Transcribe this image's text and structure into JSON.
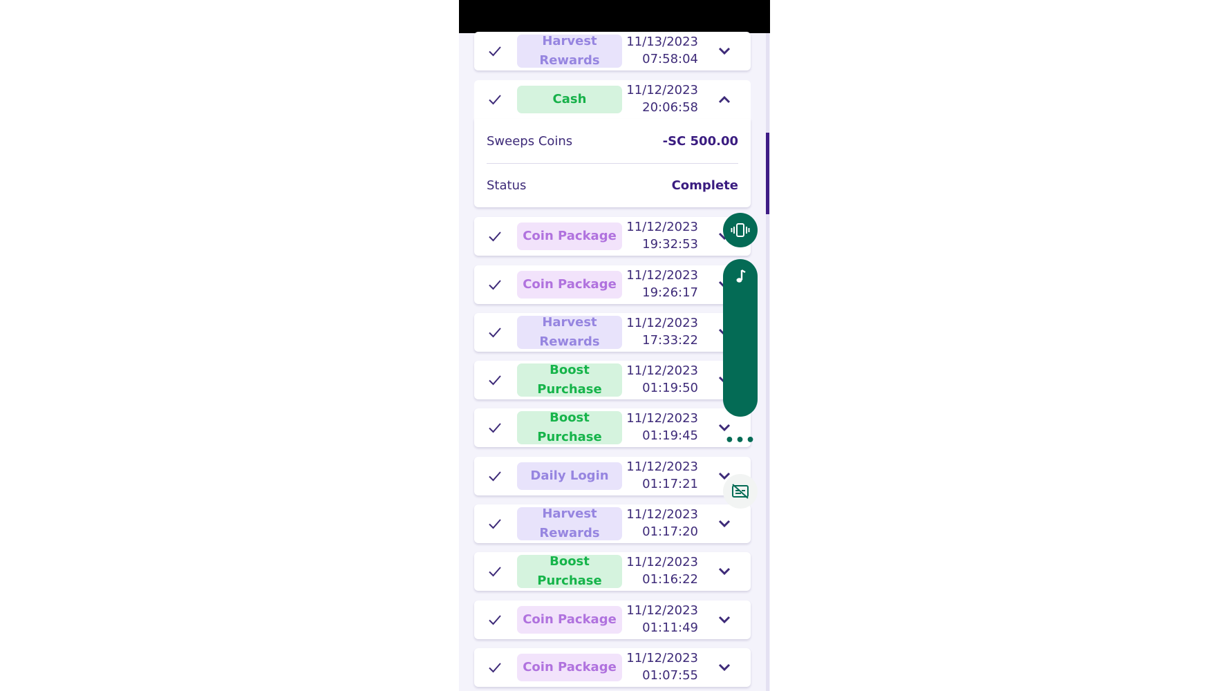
{
  "icons": {
    "check": "check-icon",
    "chevron_down": "chevron-down-icon",
    "chevron_up": "chevron-up-icon",
    "vibrate": "vibrate-icon",
    "music": "music-note-icon",
    "more": "more-dots-icon",
    "captions_off": "captions-off-icon"
  },
  "colors": {
    "accent": "#3d2a78",
    "float_button": "#046b55",
    "chip_harvest_bg": "#e8e3fb",
    "chip_cash_bg": "#d5f3de",
    "chip_coin_bg": "#f2e3fb"
  },
  "transactions": [
    {
      "type": "Harvest Rewards",
      "type_line1": "Harvest",
      "type_line2": "Rewards",
      "date": "11/13/2023",
      "time": "07:58:04",
      "expanded": false
    },
    {
      "type": "Cash",
      "type_line1": "Cash",
      "type_line2": "",
      "date": "11/12/2023",
      "time": "20:06:58",
      "expanded": true
    },
    {
      "type": "Coin Package",
      "type_line1": "Coin Package",
      "type_line2": "",
      "date": "11/12/2023",
      "time": "19:32:53",
      "expanded": false
    },
    {
      "type": "Coin Package",
      "type_line1": "Coin Package",
      "type_line2": "",
      "date": "11/12/2023",
      "time": "19:26:17",
      "expanded": false
    },
    {
      "type": "Harvest Rewards",
      "type_line1": "Harvest",
      "type_line2": "Rewards",
      "date": "11/12/2023",
      "time": "17:33:22",
      "expanded": false
    },
    {
      "type": "Boost Purchase",
      "type_line1": "Boost",
      "type_line2": "Purchase",
      "date": "11/12/2023",
      "time": "01:19:50",
      "expanded": false
    },
    {
      "type": "Boost Purchase",
      "type_line1": "Boost",
      "type_line2": "Purchase",
      "date": "11/12/2023",
      "time": "01:19:45",
      "expanded": false
    },
    {
      "type": "Daily Login",
      "type_line1": "Daily Login",
      "type_line2": "",
      "date": "11/12/2023",
      "time": "01:17:21",
      "expanded": false
    },
    {
      "type": "Harvest Rewards",
      "type_line1": "Harvest",
      "type_line2": "Rewards",
      "date": "11/12/2023",
      "time": "01:17:20",
      "expanded": false
    },
    {
      "type": "Boost Purchase",
      "type_line1": "Boost",
      "type_line2": "Purchase",
      "date": "11/12/2023",
      "time": "01:16:22",
      "expanded": false
    },
    {
      "type": "Coin Package",
      "type_line1": "Coin Package",
      "type_line2": "",
      "date": "11/12/2023",
      "time": "01:11:49",
      "expanded": false
    },
    {
      "type": "Coin Package",
      "type_line1": "Coin Package",
      "type_line2": "",
      "date": "11/12/2023",
      "time": "01:07:55",
      "expanded": false
    }
  ],
  "expanded_detail": {
    "currency_label": "Sweeps Coins",
    "amount": "-SC 500.00",
    "status_label": "Status",
    "status_value": "Complete"
  }
}
